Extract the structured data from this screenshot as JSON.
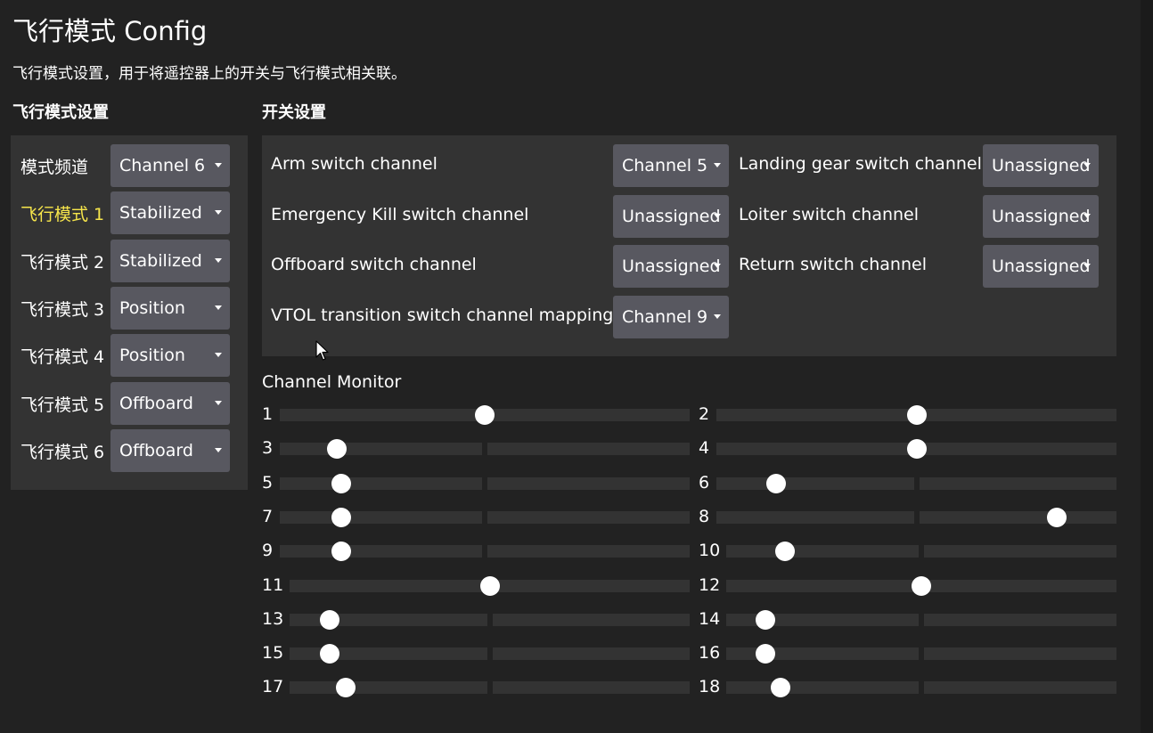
{
  "header": {
    "title": "飞行模式 Config",
    "description": "飞行模式设置，用于将遥控器上的开关与飞行模式相关联。"
  },
  "flight_mode_settings": {
    "title": "飞行模式设置",
    "rows": [
      {
        "label": "模式频道",
        "value": "Channel 6"
      },
      {
        "label": "飞行模式 1",
        "value": "Stabilized"
      },
      {
        "label": "飞行模式 2",
        "value": "Stabilized"
      },
      {
        "label": "飞行模式 3",
        "value": "Position"
      },
      {
        "label": "飞行模式 4",
        "value": "Position"
      },
      {
        "label": "飞行模式 5",
        "value": "Offboard"
      },
      {
        "label": "飞行模式 6",
        "value": "Offboard"
      }
    ]
  },
  "switch_settings": {
    "title": "开关设置",
    "left": [
      {
        "label": "Arm switch channel",
        "value": "Channel 5"
      },
      {
        "label": "Emergency Kill switch channel",
        "value": "Unassigned"
      },
      {
        "label": "Offboard switch channel",
        "value": "Unassigned"
      },
      {
        "label": "VTOL transition switch channel mapping",
        "value": "Channel 9"
      }
    ],
    "right": [
      {
        "label": "Landing gear switch channel",
        "value": "Unassigned"
      },
      {
        "label": "Loiter switch channel",
        "value": "Unassigned"
      },
      {
        "label": "Return switch channel",
        "value": "Unassigned"
      }
    ]
  },
  "channel_monitor": {
    "title": "Channel Monitor",
    "channels": [
      {
        "label": "1",
        "level": 0.5,
        "centered": false
      },
      {
        "label": "2",
        "level": 0.5,
        "centered": false
      },
      {
        "label": "3",
        "level": 0.14,
        "centered": true
      },
      {
        "label": "4",
        "level": 0.5,
        "centered": true
      },
      {
        "label": "5",
        "level": 0.15,
        "centered": true
      },
      {
        "label": "6",
        "level": 0.15,
        "centered": true
      },
      {
        "label": "7",
        "level": 0.15,
        "centered": true
      },
      {
        "label": "8",
        "level": 0.85,
        "centered": true
      },
      {
        "label": "9",
        "level": 0.15,
        "centered": true
      },
      {
        "label": "10",
        "level": 0.15,
        "centered": true
      },
      {
        "label": "11",
        "level": 0.5,
        "centered": false
      },
      {
        "label": "12",
        "level": 0.5,
        "centered": false
      },
      {
        "label": "13",
        "level": 0.1,
        "centered": true
      },
      {
        "label": "14",
        "level": 0.1,
        "centered": true
      },
      {
        "label": "15",
        "level": 0.1,
        "centered": true
      },
      {
        "label": "16",
        "level": 0.1,
        "centered": true
      },
      {
        "label": "17",
        "level": 0.14,
        "centered": true
      },
      {
        "label": "18",
        "level": 0.14,
        "centered": true
      }
    ]
  },
  "colors": {
    "background": "#222222",
    "panel": "#333333",
    "combo": "#585860",
    "active_label": "#f7e64b",
    "text": "#ffffff"
  }
}
